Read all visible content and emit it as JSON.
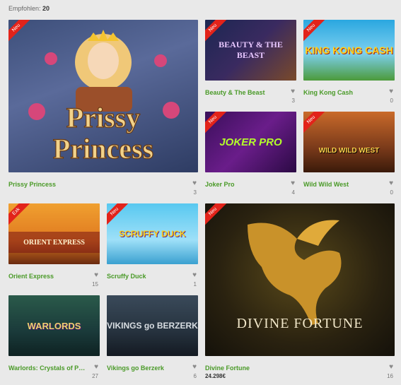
{
  "header": {
    "label": "Empfohlen:",
    "count": "20"
  },
  "games": [
    {
      "title": "Prissy Princess",
      "badge": "Neu",
      "likes": "3",
      "art": "Prissy Princess"
    },
    {
      "title": "Beauty & The Beast",
      "badge": "Neu",
      "likes": "3",
      "art": "BEAUTY & THE BEAST"
    },
    {
      "title": "King Kong Cash",
      "badge": "Neu",
      "likes": "0",
      "art": "KING KONG CASH"
    },
    {
      "title": "Joker Pro",
      "badge": "Neu",
      "likes": "4",
      "art": "JOKER PRO"
    },
    {
      "title": "Wild Wild West",
      "badge": "Neu",
      "likes": "0",
      "art": "WILD WILD WEST"
    },
    {
      "title": "Orient Express",
      "badge": "Exk",
      "likes": "15",
      "art": "ORIENT EXPRESS"
    },
    {
      "title": "Scruffy Duck",
      "badge": "Neu",
      "likes": "1",
      "art": "SCRUFFY DUCK"
    },
    {
      "title": "Divine Fortune",
      "badge": "Neu",
      "likes": "16",
      "jackpot": "24.298€",
      "art": "DIVINE FORTUNE"
    },
    {
      "title": "Warlords: Crystals of Power",
      "badge": "",
      "likes": "27",
      "art": "WARLORDS"
    },
    {
      "title": "Vikings go Berzerk",
      "badge": "",
      "likes": "6",
      "art": "VIKINGS go BERZERK"
    }
  ],
  "icons": {
    "like": "heart-icon"
  },
  "colors": {
    "title_green": "#4a9a28",
    "badge_red": "#e2231a"
  }
}
